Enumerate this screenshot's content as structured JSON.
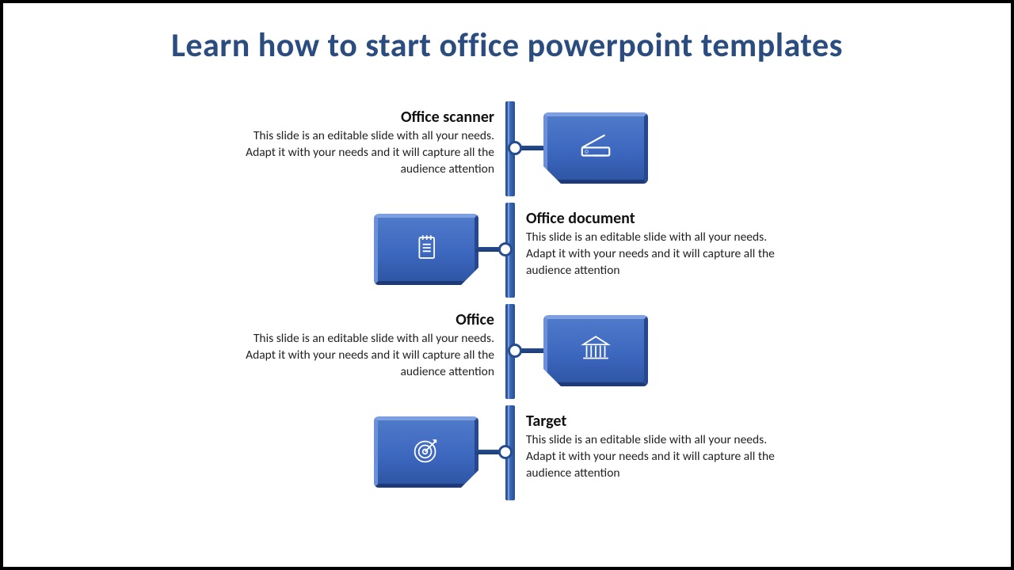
{
  "title": "Learn how to start office powerpoint templates",
  "body": "This slide is an editable slide with all your needs. Adapt it with your needs and it will capture all the audience attention",
  "items": [
    {
      "heading": "Office scanner",
      "icon": "scanner-icon",
      "side": "right"
    },
    {
      "heading": "Office document",
      "icon": "document-icon",
      "side": "left"
    },
    {
      "heading": "Office",
      "icon": "building-icon",
      "side": "right"
    },
    {
      "heading": "Target",
      "icon": "target-icon",
      "side": "left"
    }
  ],
  "colors": {
    "accent": "#3d68bf",
    "heading": "#2b4c7e"
  }
}
